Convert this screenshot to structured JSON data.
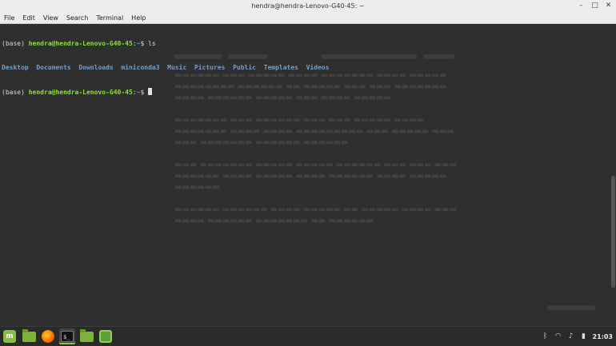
{
  "window": {
    "title": "hendra@hendra-Lenovo-G40-45: ~"
  },
  "menu": [
    "File",
    "Edit",
    "View",
    "Search",
    "Terminal",
    "Help"
  ],
  "terminal": {
    "prompt_env": "(base)",
    "prompt_user": "hendra@hendra-Lenovo-G40-45",
    "prompt_sep": ":",
    "prompt_path": "~",
    "prompt_end": "$",
    "command": "ls",
    "listing": [
      "Desktop",
      "Documents",
      "Downloads",
      "miniconda3",
      "Music",
      "Pictures",
      "Public",
      "Templates",
      "Videos"
    ]
  },
  "taskbar": {
    "clock": "21:03",
    "icons": [
      "menu-icon",
      "files-icon",
      "firefox-icon",
      "terminal-icon",
      "folder-icon",
      "software-manager-icon"
    ]
  },
  "colors": {
    "prompt_user": "#8ae234",
    "prompt_path": "#729fcf",
    "directory": "#729fcf",
    "mint_green": "#86be43"
  }
}
